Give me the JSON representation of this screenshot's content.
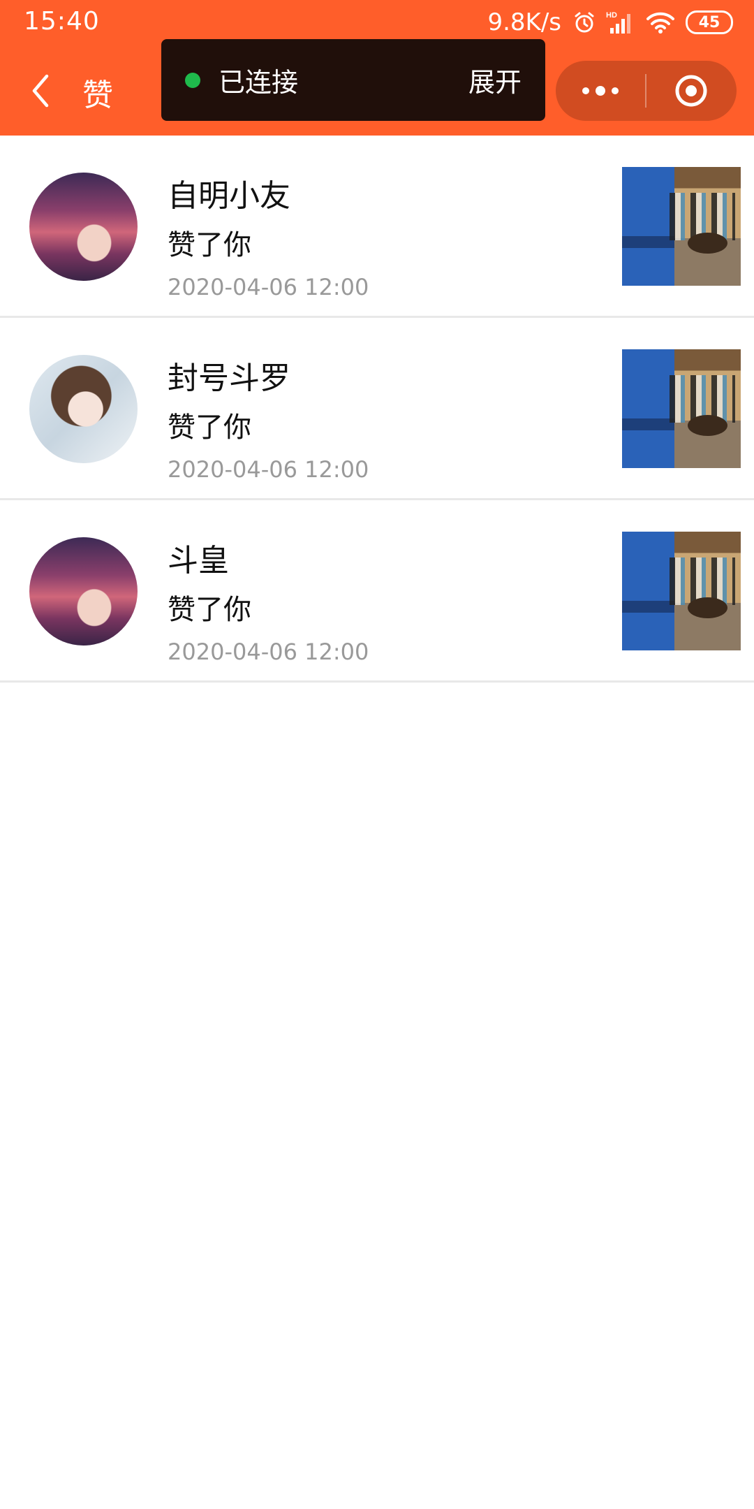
{
  "status_bar": {
    "time": "15:40",
    "net_speed": "9.8K/s",
    "battery": "45",
    "icons": [
      "alarm-icon",
      "signal-hd-icon",
      "wifi-icon",
      "battery-icon"
    ]
  },
  "header": {
    "title": "赞",
    "back_icon": "chevron-left-icon",
    "connection": {
      "status": "已连接",
      "expand_label": "展开",
      "dot_color": "#1fba4c"
    },
    "capsule": {
      "more_icon": "more-dots-icon",
      "close_icon": "target-circle-icon"
    }
  },
  "likes": [
    {
      "user": "自明小友",
      "action": "赞了你",
      "time": "2020-04-06 12:00"
    },
    {
      "user": "封号斗罗",
      "action": "赞了你",
      "time": "2020-04-06 12:00"
    },
    {
      "user": "斗皇",
      "action": "赞了你",
      "time": "2020-04-06 12:00"
    }
  ],
  "colors": {
    "header_bg": "#ff5e2a",
    "toast_bg": "#200f0a",
    "capsule_bg": "#d14c21",
    "time_text": "#999999"
  }
}
